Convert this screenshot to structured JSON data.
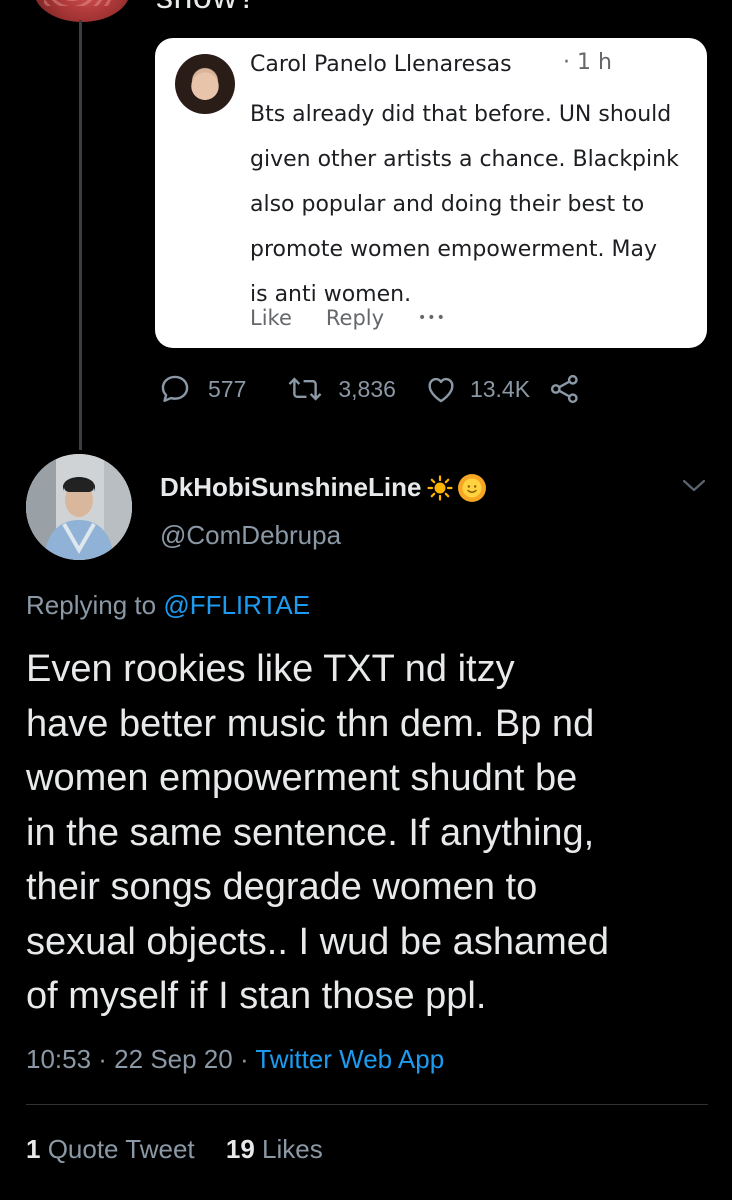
{
  "previous_tweet": {
    "text_fragment": "show?"
  },
  "embedded_comment": {
    "author": "Carol Panelo Llenaresas",
    "time": "· 1 h",
    "lines": [
      "Bts already did that before. UN should",
      "given other artists a chance. Blackpink",
      "also popular and doing their best to",
      "promote women empowerment. May",
      "is anti women."
    ],
    "like_label": "Like",
    "reply_label": "Reply",
    "more_label": "•••"
  },
  "previous_stats": {
    "replies": "577",
    "retweets": "3,836",
    "likes": "13.4K"
  },
  "tweet": {
    "display_name": "DkHobiSunshineLine",
    "handle": "@ComDebrupa",
    "replying_prefix": "Replying to ",
    "replying_to": "@FFLIRTAE",
    "lines": [
      "Even rookies like TXT nd itzy",
      "have better music thn dem. Bp nd",
      "women empowerment shudnt be",
      "in the same sentence. If anything,",
      "their songs degrade women to",
      "sexual objects.. I wud be ashamed",
      "of myself if I stan those ppl."
    ],
    "time": "10:53 · 22 Sep 20 · ",
    "source": "Twitter Web App",
    "quote_count": "1",
    "quote_label": " Quote Tweet",
    "like_count": "19",
    "like_label": " Likes"
  },
  "colors": {
    "background": "#000000",
    "text": "#e7e9ea",
    "muted": "#8b98a5",
    "accent": "#1d9bf0"
  }
}
